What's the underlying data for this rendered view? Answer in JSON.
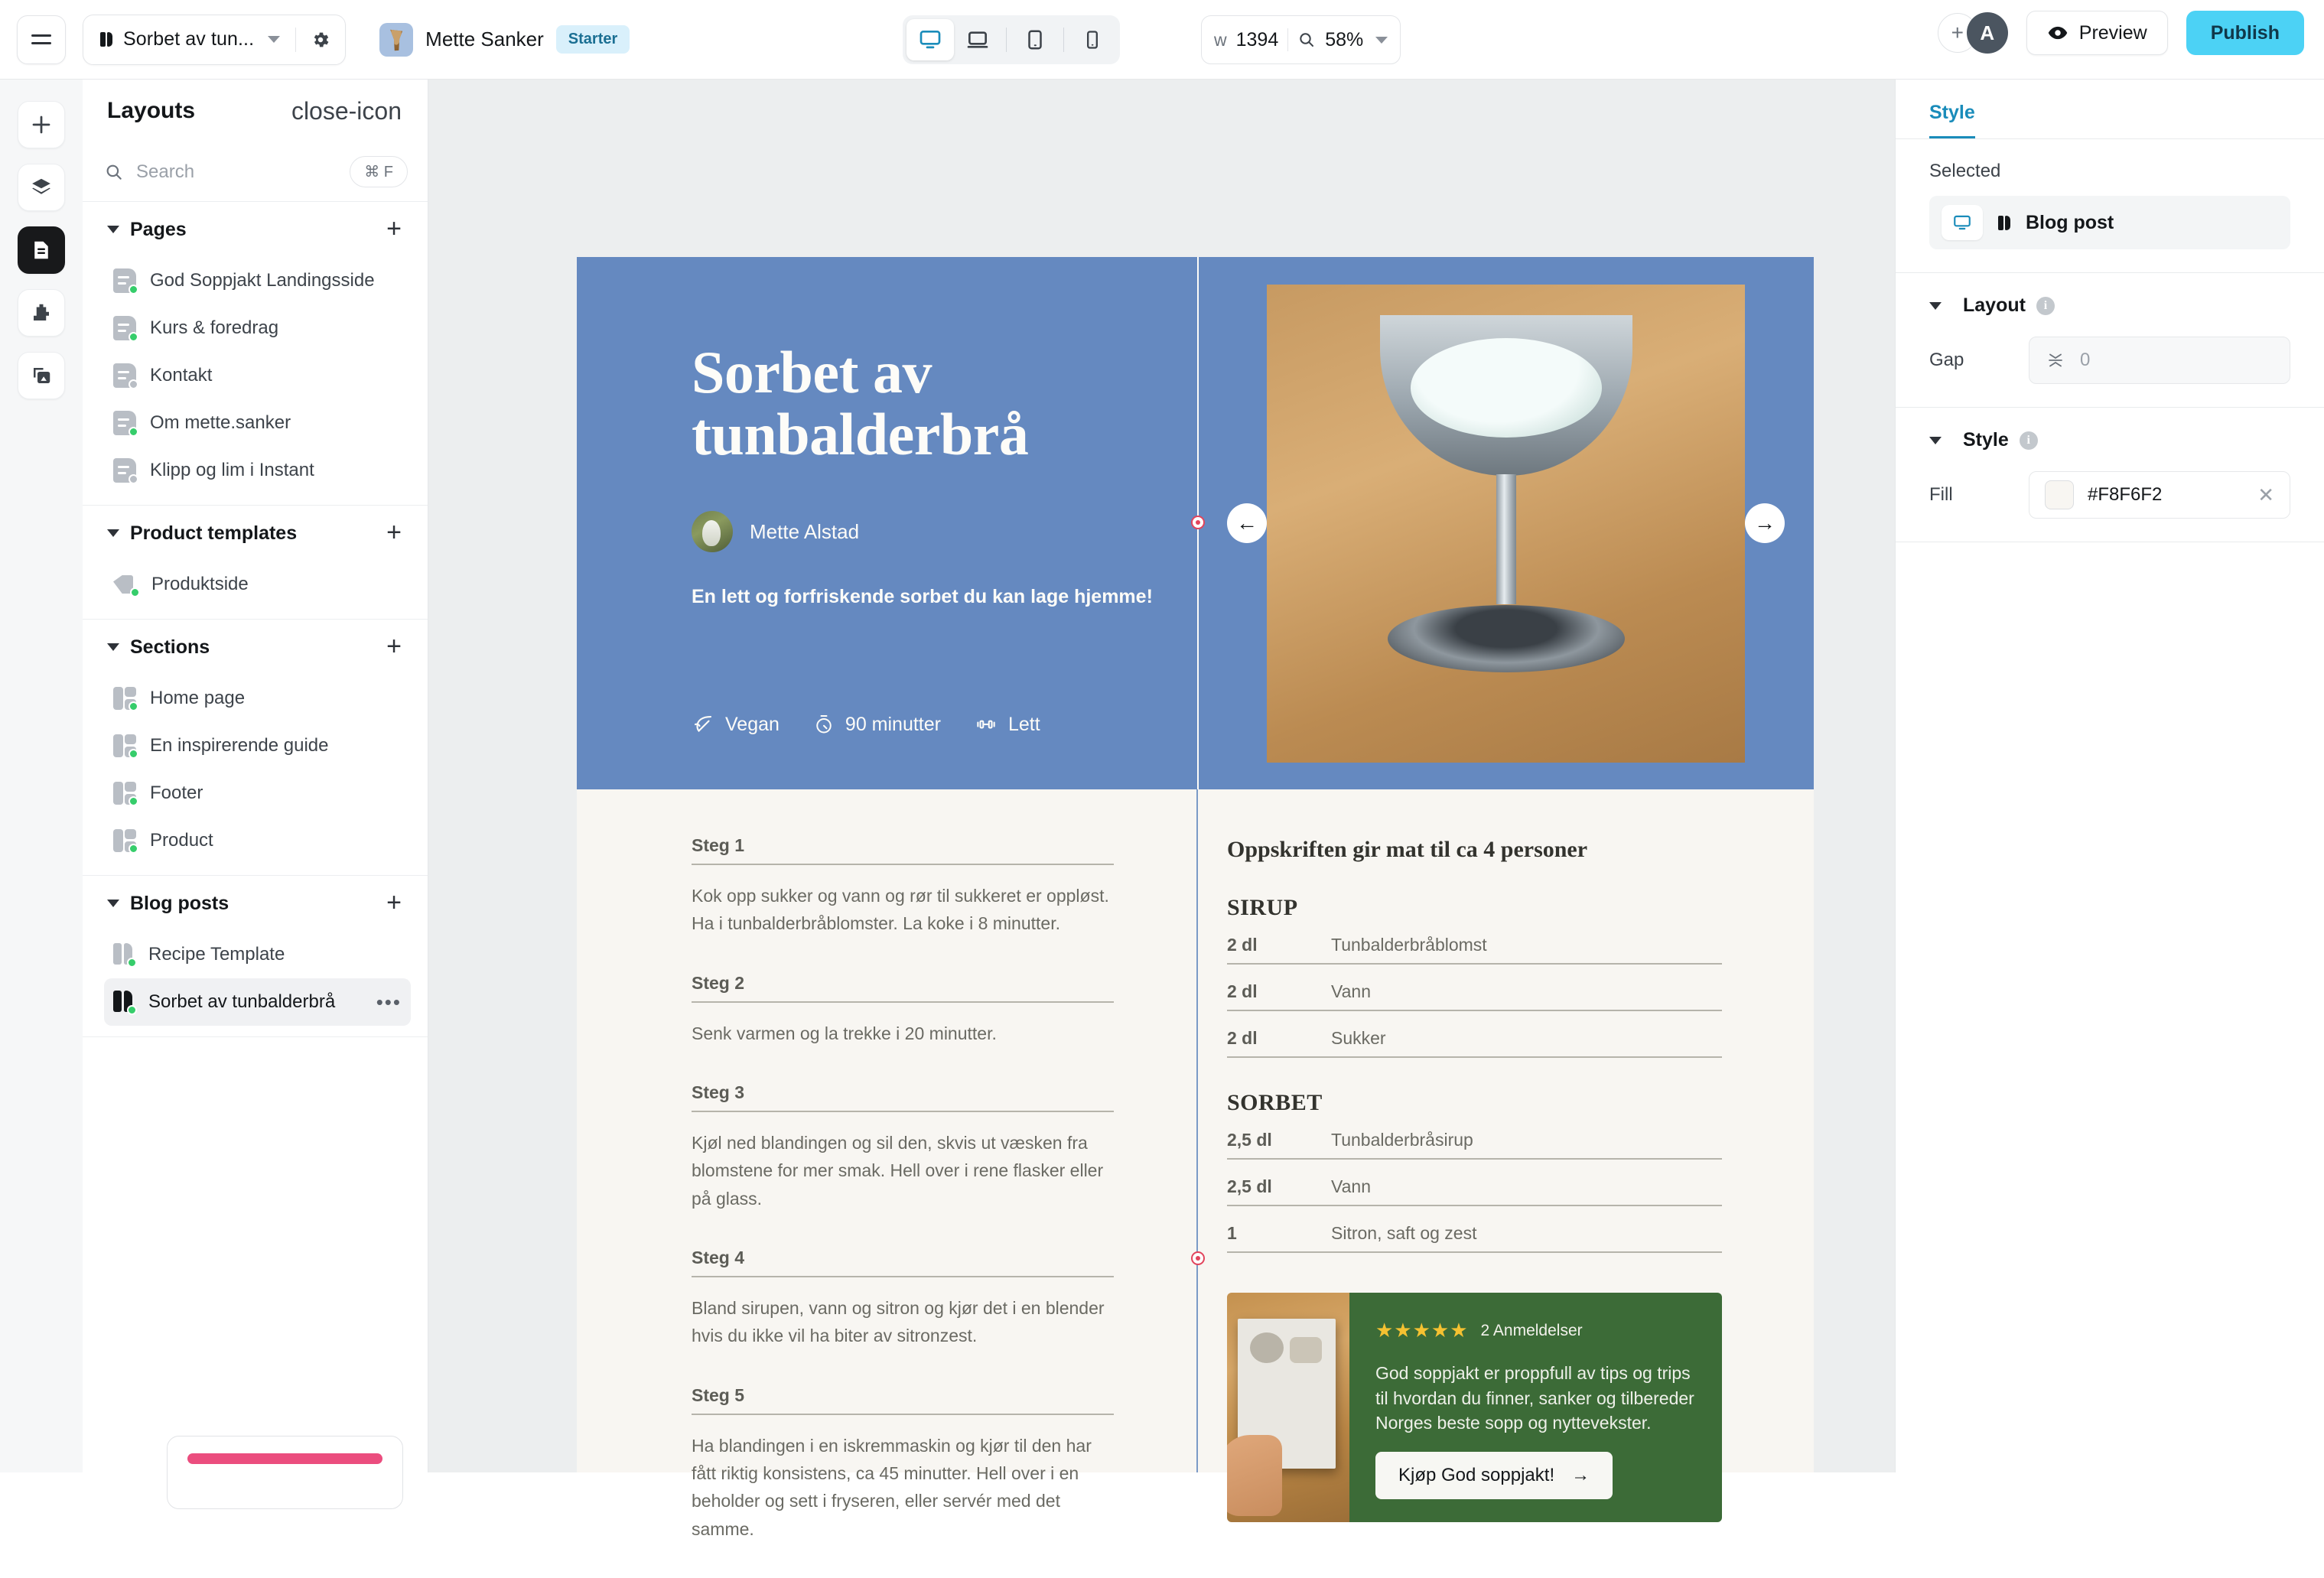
{
  "topbar": {
    "menu_icon": "hamburger-icon",
    "project_name": "Sorbet av tun...",
    "project_settings_icon": "gear-icon",
    "account_name": "Mette Sanker",
    "plan_badge": "Starter",
    "viewports": [
      {
        "name": "desktop",
        "icon": "monitor-icon",
        "active": true
      },
      {
        "name": "laptop",
        "icon": "laptop-icon",
        "active": false
      },
      {
        "name": "tablet",
        "icon": "tablet-icon",
        "active": false
      },
      {
        "name": "mobile",
        "icon": "mobile-icon",
        "active": false
      }
    ],
    "width_prefix": "w",
    "width_value": "1394",
    "zoom_value": "58%",
    "avatar_initial": "A",
    "add_user_label": "+",
    "preview_label": "Preview",
    "publish_label": "Publish",
    "publish_color": "#4CD2F5",
    "accent_color": "#1A8CBA"
  },
  "rail": [
    {
      "name": "add",
      "icon": "plus-icon",
      "active": false
    },
    {
      "name": "layers",
      "icon": "layers-icon",
      "active": false
    },
    {
      "name": "pages",
      "icon": "document-icon",
      "active": true
    },
    {
      "name": "components",
      "icon": "puzzle-icon",
      "active": false
    },
    {
      "name": "assets",
      "icon": "image-stack-icon",
      "active": false
    }
  ],
  "panel": {
    "title": "Layouts",
    "close_icon": "close-icon",
    "search_placeholder": "Search",
    "search_value": "",
    "search_shortcut": "⌘ F",
    "groups": [
      {
        "name": "Pages",
        "add_label": "+",
        "items": [
          {
            "label": "God Soppjakt Landingsside",
            "icon": "page-icon",
            "status": "published"
          },
          {
            "label": "Kurs & foredrag",
            "icon": "page-icon",
            "status": "published"
          },
          {
            "label": "Kontakt",
            "icon": "page-icon",
            "status": "draft"
          },
          {
            "label": "Om mette.sanker",
            "icon": "page-icon",
            "status": "published"
          },
          {
            "label": "Klipp og lim i Instant",
            "icon": "page-icon",
            "status": "draft"
          }
        ]
      },
      {
        "name": "Product templates",
        "add_label": "+",
        "items": [
          {
            "label": "Produktside",
            "icon": "tag-icon",
            "status": "published"
          }
        ]
      },
      {
        "name": "Sections",
        "add_label": "+",
        "items": [
          {
            "label": "Home page",
            "icon": "section-icon",
            "status": "published"
          },
          {
            "label": "En inspirerende guide",
            "icon": "section-icon",
            "status": "published"
          },
          {
            "label": "Footer",
            "icon": "section-icon",
            "status": "published"
          },
          {
            "label": "Product",
            "icon": "section-icon",
            "status": "published"
          }
        ]
      },
      {
        "name": "Blog posts",
        "add_label": "+",
        "items": [
          {
            "label": "Recipe Template",
            "icon": "blogpost-icon",
            "status": "published"
          },
          {
            "label": "Sorbet av tunbalderbrå",
            "icon": "blogpost-icon",
            "status": "published",
            "active": true,
            "more_label": "•••"
          }
        ]
      }
    ]
  },
  "canvas": {
    "hero": {
      "background_color": "#6589C0",
      "title": "Sorbet av tunbalderbrå",
      "author": "Mette Alstad",
      "subtitle": "En lett og forfriskende sorbet du kan lage hjemme!",
      "meta": [
        {
          "icon": "leaf-icon",
          "label": "Vegan"
        },
        {
          "icon": "timer-icon",
          "label": "90 minutter"
        },
        {
          "icon": "weight-icon",
          "label": "Lett"
        }
      ],
      "prev_arrow": "←",
      "next_arrow": "→"
    },
    "steps": [
      {
        "title": "Steg 1",
        "body": "Kok opp sukker og vann og rør til sukkeret er oppløst. Ha i tunbalderbråblomster. La koke i 8 minutter."
      },
      {
        "title": "Steg 2",
        "body": "Senk varmen og la trekke i 20 minutter."
      },
      {
        "title": "Steg 3",
        "body": "Kjøl ned blandingen og sil den, skvis ut væsken fra blomstene for mer smak. Hell over i rene flasker eller på glass."
      },
      {
        "title": "Steg 4",
        "body": "Bland sirupen, vann og sitron og kjør det i en blender hvis du ikke vil ha biter av sitronzest."
      },
      {
        "title": "Steg 5",
        "body": "Ha blandingen i en iskremmaskin og kjør til den har fått riktig konsistens, ca 45 minutter. Hell over i en beholder og sett i fryseren, eller servér med det samme."
      }
    ],
    "ingredients": {
      "servings": "Oppskriften gir mat til ca 4 personer",
      "groups": [
        {
          "name": "SIRUP",
          "rows": [
            {
              "qty": "2 dl",
              "name": "Tunbalderbråblomst"
            },
            {
              "qty": "2 dl",
              "name": "Vann"
            },
            {
              "qty": "2 dl",
              "name": "Sukker"
            }
          ]
        },
        {
          "name": "SORBET",
          "rows": [
            {
              "qty": "2,5 dl",
              "name": "Tunbalderbråsirup"
            },
            {
              "qty": "2,5 dl",
              "name": "Vann"
            },
            {
              "qty": "1",
              "name": "Sitron, saft og zest"
            }
          ]
        }
      ]
    },
    "promo": {
      "background_color": "#3C6B37",
      "stars": "★★★★★",
      "review_count": "2 Anmeldelser",
      "text": "God soppjakt er proppfull av tips og trips til hvordan du finner, sanker og tilbereder Norges beste sopp og nyttevekster.",
      "button_label": "Kjøp God soppjakt!",
      "button_arrow": "→"
    }
  },
  "style_panel": {
    "tab": "Style",
    "selected_label": "Selected",
    "selected_item": "Blog post",
    "selected_viewport_icon": "monitor-icon",
    "layout_section": "Layout",
    "gap_label": "Gap",
    "gap_value": "0",
    "style_section": "Style",
    "fill_label": "Fill",
    "fill_value": "#F8F6F2",
    "clear_icon": "close-icon"
  }
}
